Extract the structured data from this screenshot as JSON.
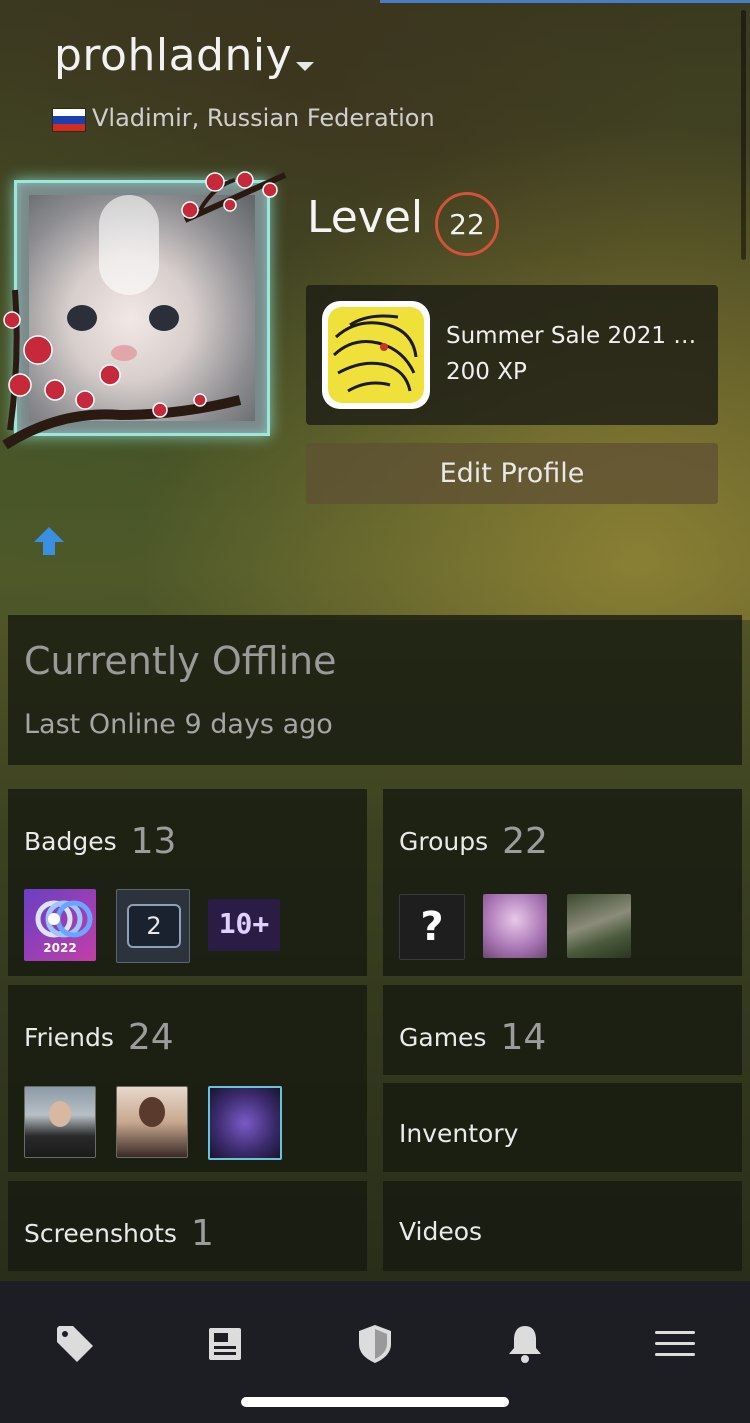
{
  "profile": {
    "username": "prohladniy",
    "location": "Vladimir, Russian Federation",
    "level_label": "Level",
    "level": "22",
    "featured_badge": {
      "title": "Summer Sale 2021 - ...",
      "xp": "200 XP"
    },
    "edit_profile_label": "Edit Profile"
  },
  "status": {
    "title": "Currently Offline",
    "last_online": "Last Online 9 days ago"
  },
  "sections": {
    "badges": {
      "label": "Badges",
      "count": "13",
      "items": [
        "2022",
        "2",
        "10+"
      ]
    },
    "groups": {
      "label": "Groups",
      "count": "22",
      "items": [
        "?"
      ]
    },
    "friends": {
      "label": "Friends",
      "count": "24"
    },
    "games": {
      "label": "Games",
      "count": "14"
    },
    "inventory": {
      "label": "Inventory"
    },
    "screenshots": {
      "label": "Screenshots",
      "count": "1"
    },
    "videos": {
      "label": "Videos"
    }
  },
  "nav": [
    "tag-icon",
    "news-icon",
    "shield-icon",
    "bell-icon",
    "menu-icon"
  ],
  "colors": {
    "level_ring": "#d0533a",
    "accent_blue": "#4a7cc4",
    "avatar_glow": "#9fe5da"
  }
}
